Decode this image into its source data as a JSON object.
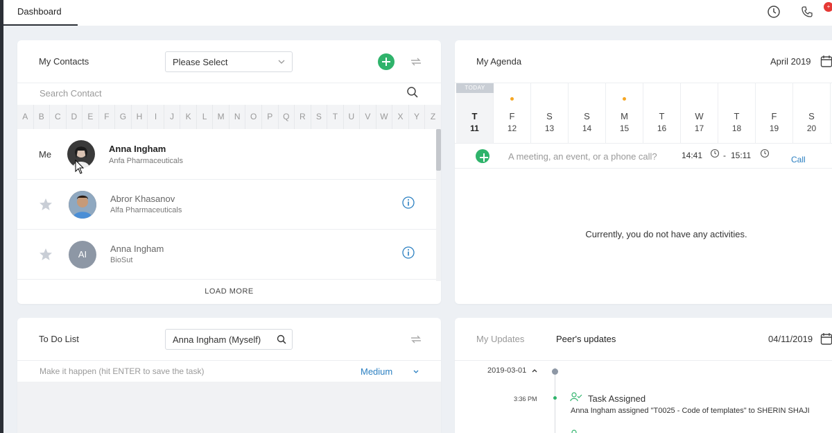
{
  "topbar": {
    "tab_label": "Dashboard",
    "badge_count": "+"
  },
  "contacts": {
    "title": "My Contacts",
    "select_value": "Please Select",
    "search_placeholder": "Search Contact",
    "alphabet": [
      "A",
      "B",
      "C",
      "D",
      "E",
      "F",
      "G",
      "H",
      "I",
      "J",
      "K",
      "L",
      "M",
      "N",
      "O",
      "P",
      "Q",
      "R",
      "S",
      "T",
      "U",
      "V",
      "W",
      "X",
      "Y",
      "Z"
    ],
    "me_label": "Me",
    "rows": [
      {
        "name": "Anna Ingham",
        "company": "Anfa Pharmaceuticals"
      },
      {
        "name": "Abror Khasanov",
        "company": "Alfa Pharmaceuticals"
      },
      {
        "name": "Anna Ingham",
        "company": "BioSut",
        "initials": "AI"
      }
    ],
    "load_more": "LOAD MORE"
  },
  "agenda": {
    "title": "My Agenda",
    "month": "April 2019",
    "today_tag": "TODAY",
    "days": [
      {
        "letter": "T",
        "num": "11",
        "today": true,
        "dot": false
      },
      {
        "letter": "F",
        "num": "12",
        "dot": true
      },
      {
        "letter": "S",
        "num": "13",
        "dot": false
      },
      {
        "letter": "S",
        "num": "14",
        "dot": false
      },
      {
        "letter": "M",
        "num": "15",
        "dot": true
      },
      {
        "letter": "T",
        "num": "16",
        "dot": false
      },
      {
        "letter": "W",
        "num": "17",
        "dot": false
      },
      {
        "letter": "T",
        "num": "18",
        "dot": false
      },
      {
        "letter": "F",
        "num": "19",
        "dot": false
      },
      {
        "letter": "S",
        "num": "20",
        "dot": false
      }
    ],
    "new_placeholder": "A meeting, an event, or a phone call?",
    "start_time": "14:41",
    "dash": "-",
    "end_time": "15:11",
    "type_label": "Call",
    "empty_message": "Currently, you do not have any activities."
  },
  "todo": {
    "title": "To Do List",
    "field_value": "Anna Ingham (Myself)",
    "task_placeholder": "Make it happen (hit ENTER to save the task)",
    "priority": "Medium"
  },
  "updates": {
    "tab_mine": "My Updates",
    "tab_peers": "Peer's updates",
    "date": "04/11/2019",
    "group_date": "2019-03-01",
    "entry_time": "3:36 PM",
    "entry_title": "Task Assigned",
    "entry_text": "Anna Ingham assigned \"T0025 - Code of templates\" to SHERIN SHAJI"
  },
  "colors": {
    "accent_green": "#2fb36b",
    "link_blue": "#2a7fc1",
    "agenda_dot": "#f5a623"
  }
}
